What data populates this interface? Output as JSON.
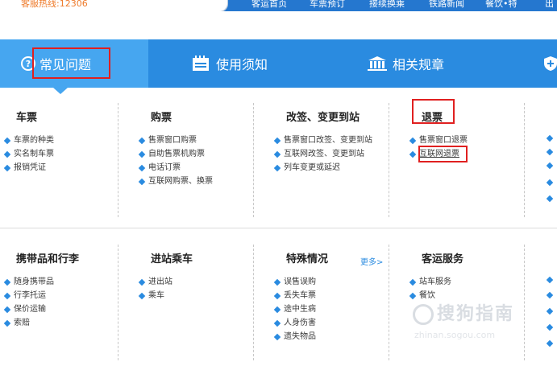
{
  "topbar": {
    "hotline": "客服热线:12306",
    "nav": [
      "客运首页",
      "车票预订",
      "接续换乘",
      "铁路新闻",
      "餐饮•特",
      "出"
    ]
  },
  "tabs": [
    {
      "label": "常见问题",
      "active": true
    },
    {
      "label": "使用须知"
    },
    {
      "label": "相关规章"
    }
  ],
  "columns_row1": [
    {
      "title": "车票",
      "items": [
        "车票的种类",
        "实名制车票",
        "报销凭证"
      ]
    },
    {
      "title": "购票",
      "items": [
        "售票窗口购票",
        "自助售票机购票",
        "电话订票",
        "互联网购票、换票"
      ]
    },
    {
      "title": "改签、变更到站",
      "items": [
        "售票窗口改签、变更到站",
        "互联网改签、变更到站",
        "列车变更或延迟"
      ]
    },
    {
      "title": "退票",
      "items": [
        "售票窗口退票",
        "互联网退票"
      ]
    }
  ],
  "columns_row2": [
    {
      "title": "携带品和行李",
      "items": [
        "随身携带品",
        "行李托运",
        "保价运输",
        "索赔"
      ]
    },
    {
      "title": "进站乘车",
      "items": [
        "进出站",
        "乘车"
      ]
    },
    {
      "title": "特殊情况",
      "more": "更多>",
      "items": [
        "误售误购",
        "丢失车票",
        "途中生病",
        "人身伤害",
        "遗失物品"
      ]
    },
    {
      "title": "客运服务",
      "items": [
        "站车服务",
        "餐饮"
      ]
    }
  ],
  "watermark": {
    "text": "搜狗指南",
    "sub": "zhinan.sogou.com"
  },
  "colors": {
    "tab_bar": "#2a8be0",
    "tab_active": "#46a6f0",
    "highlight": "#e02020",
    "hotline": "#ee7a2a"
  }
}
